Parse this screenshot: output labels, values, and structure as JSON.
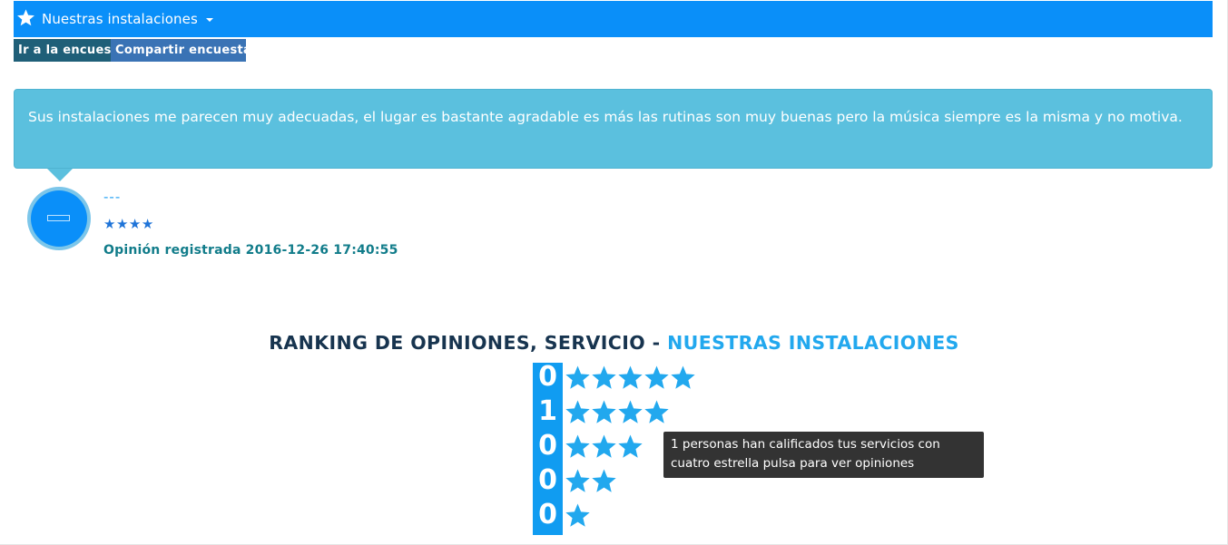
{
  "header": {
    "title": "Nuestras instalaciones",
    "icon": "star-icon",
    "background": "#0a8ff9"
  },
  "actions": {
    "go_survey_label": "Ir a la encuesta",
    "share_survey_label": "Compartir encuesta"
  },
  "review": {
    "comment": "Sus instalaciones me parecen muy adecuadas, el lugar es bastante agradable es más las rutinas son muy buenas pero la música siempre es la misma y no motiva.",
    "author": "---",
    "stars_text": "★★★★",
    "rating": 4,
    "registered": "Opinión registrada 2016-12-26 17:40:55"
  },
  "ranking": {
    "title_prefix": "RANKING DE OPINIONES, SERVICIO - ",
    "title_service": "NUESTRAS INSTALACIONES",
    "rows": [
      {
        "count": "0",
        "stars": 5
      },
      {
        "count": "1",
        "stars": 4
      },
      {
        "count": "0",
        "stars": 3
      },
      {
        "count": "0",
        "stars": 2
      },
      {
        "count": "0",
        "stars": 1
      }
    ],
    "star_color": "#22a8ee"
  },
  "tooltip": {
    "text": "1 personas han calificados tus servicios con cuatro estrella pulsa para ver opiniones"
  }
}
